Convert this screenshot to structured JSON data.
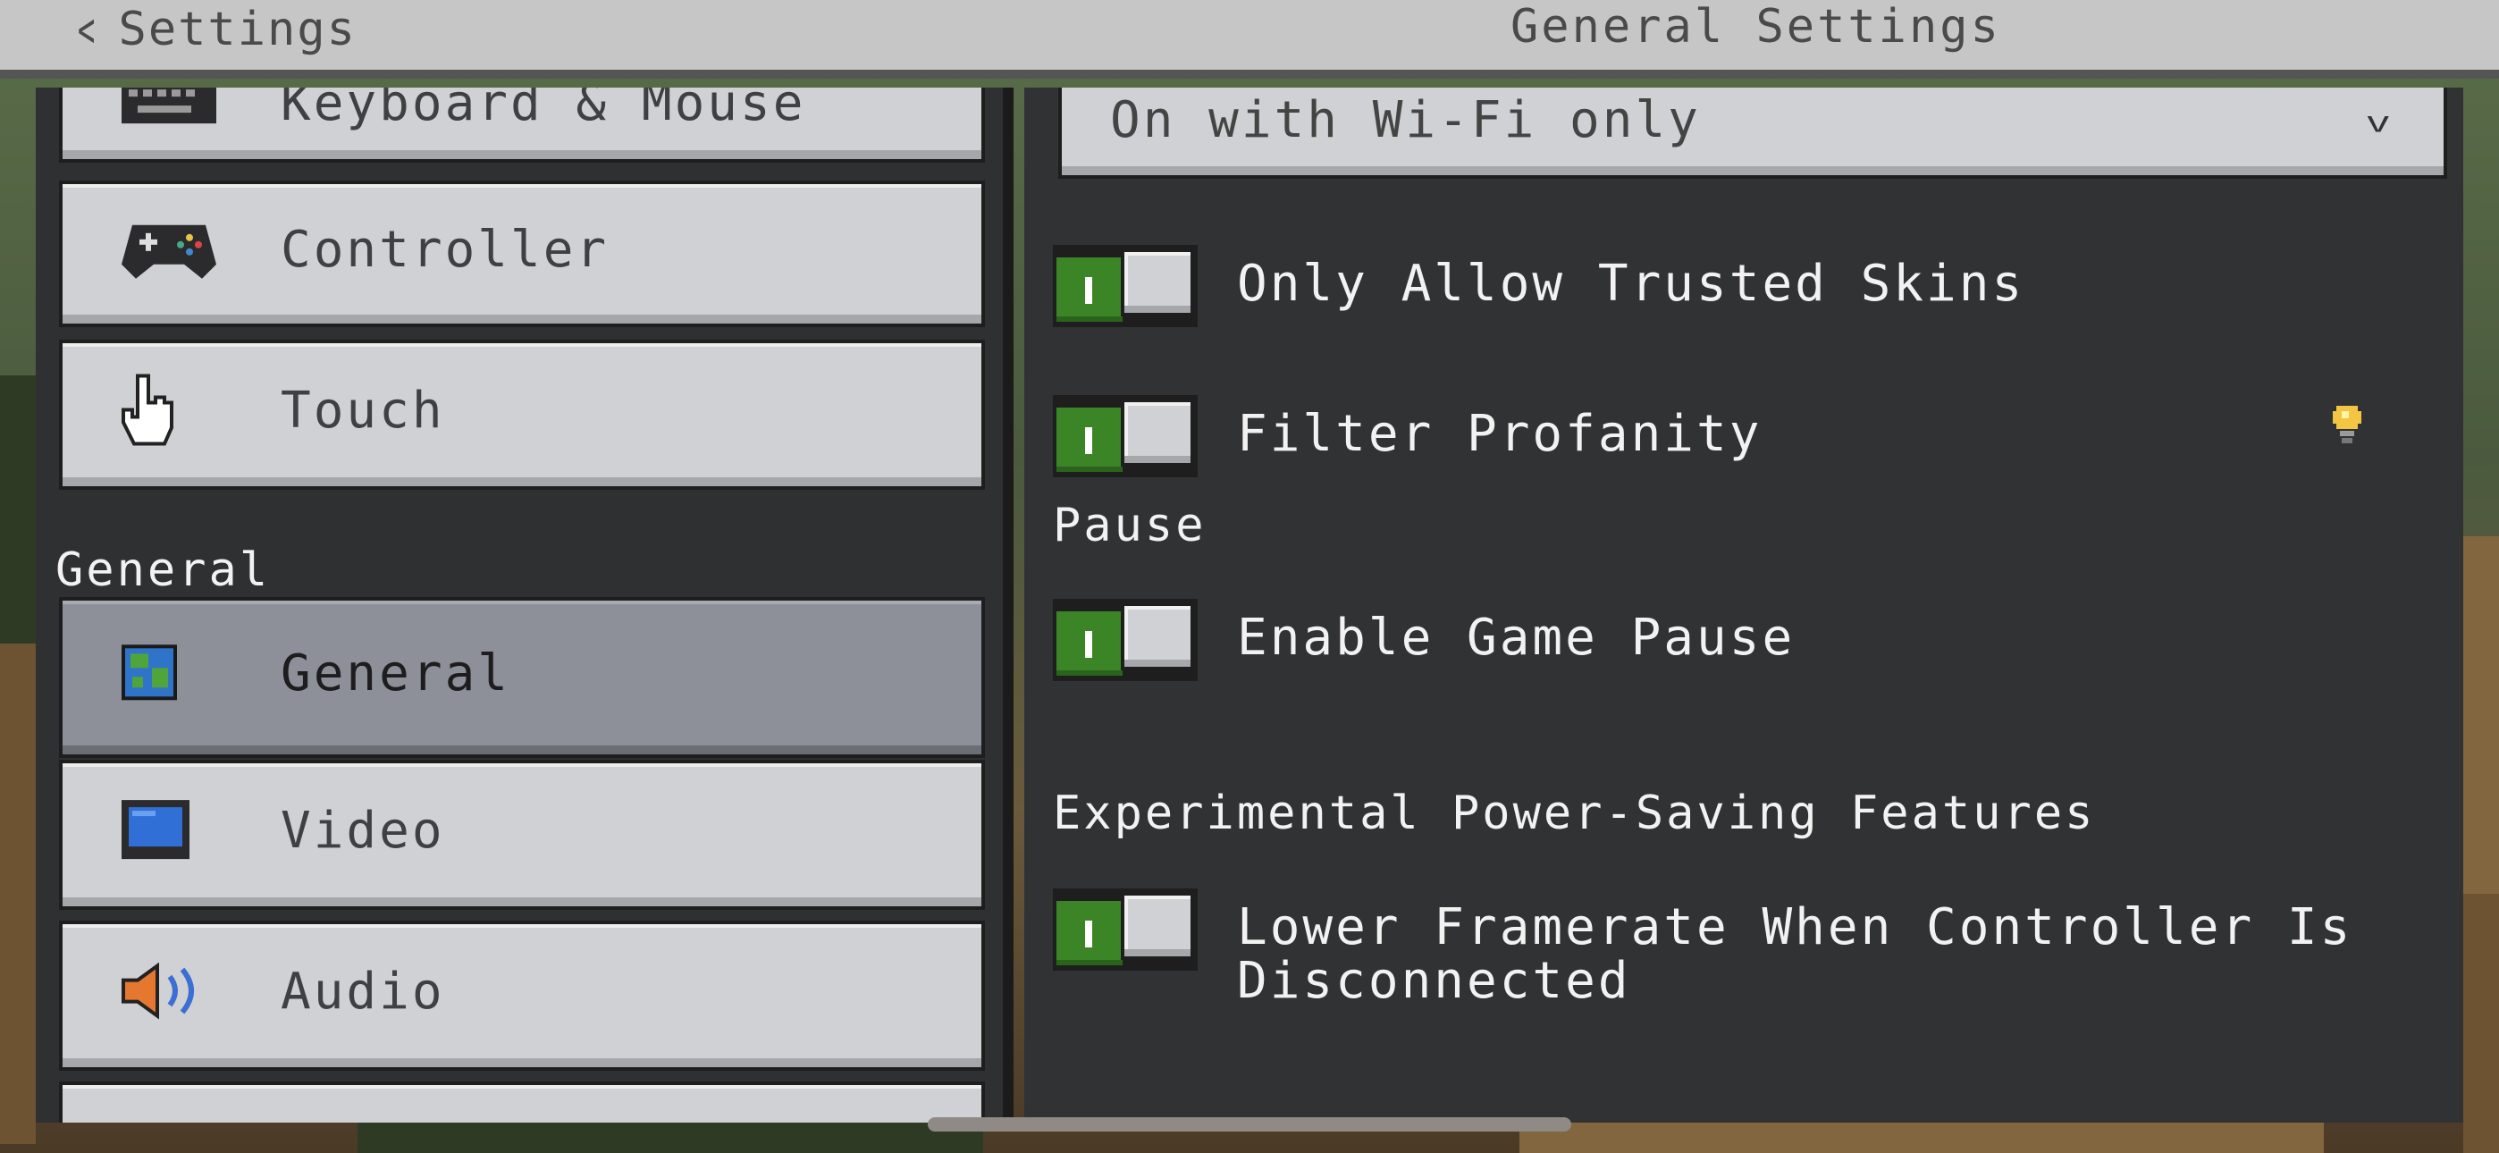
{
  "header": {
    "back_label": "Settings",
    "title": "General Settings"
  },
  "sidebar": {
    "items_top": [
      {
        "label": "Keyboard & Mouse",
        "icon": "keyboard-icon"
      },
      {
        "label": "Controller",
        "icon": "gamepad-icon"
      },
      {
        "label": "Touch",
        "icon": "hand-pointer-icon"
      }
    ],
    "section_label": "General",
    "items_general": [
      {
        "label": "General",
        "icon": "globe-icon",
        "selected": true
      },
      {
        "label": "Video",
        "icon": "monitor-icon"
      },
      {
        "label": "Audio",
        "icon": "speaker-icon"
      }
    ]
  },
  "panel": {
    "dropdown_value": "On with Wi-Fi only",
    "toggles_top": [
      {
        "label": "Only Allow Trusted Skins",
        "on": true
      },
      {
        "label": "Filter Profanity",
        "on": true,
        "hint_icon": "lightbulb-icon"
      }
    ],
    "pause_section": "Pause",
    "pause_toggle": {
      "label": "Enable Game Pause",
      "on": true
    },
    "power_section": "Experimental Power-Saving Features",
    "power_toggle": {
      "label": "Lower Framerate When Controller Is\nDisconnected",
      "on": true
    }
  },
  "colors": {
    "toggle_on": "#3c8527",
    "button_face": "#d0d1d4",
    "selected_face": "#8d9098",
    "panel_bg": "#313234"
  }
}
